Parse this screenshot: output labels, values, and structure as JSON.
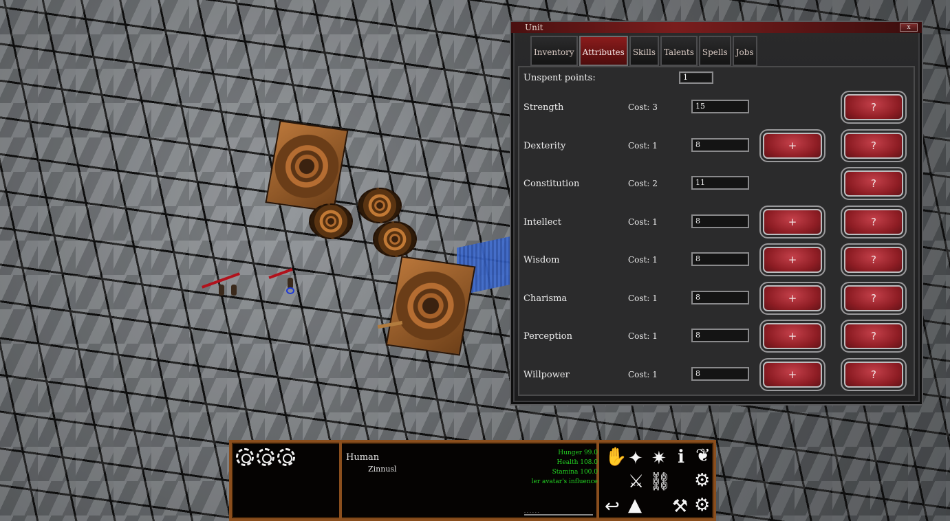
{
  "window": {
    "title": "Unit",
    "close_label": "x",
    "tabs": [
      {
        "label": "Inventory",
        "active": false
      },
      {
        "label": "Attributes",
        "active": true
      },
      {
        "label": "Skills",
        "active": false
      },
      {
        "label": "Talents",
        "active": false
      },
      {
        "label": "Spells",
        "active": false
      },
      {
        "label": "Jobs",
        "active": false
      }
    ],
    "unspent_label": "Unspent points:",
    "unspent_value": "1",
    "plus_label": "+",
    "help_label": "?",
    "attributes": [
      {
        "name": "Strength",
        "cost": "Cost: 3",
        "value": "15",
        "can_raise": false
      },
      {
        "name": "Dexterity",
        "cost": "Cost: 1",
        "value": "8",
        "can_raise": true
      },
      {
        "name": "Constitution",
        "cost": "Cost: 2",
        "value": "11",
        "can_raise": false
      },
      {
        "name": "Intellect",
        "cost": "Cost: 1",
        "value": "8",
        "can_raise": true
      },
      {
        "name": "Wisdom",
        "cost": "Cost: 1",
        "value": "8",
        "can_raise": true
      },
      {
        "name": "Charisma",
        "cost": "Cost: 1",
        "value": "8",
        "can_raise": true
      },
      {
        "name": "Perception",
        "cost": "Cost: 1",
        "value": "8",
        "can_raise": true
      },
      {
        "name": "Willpower",
        "cost": "Cost: 1",
        "value": "8",
        "can_raise": true
      }
    ]
  },
  "hud": {
    "race": "Human",
    "unit_name": "Zinnusl",
    "stats": {
      "hunger": "Hunger 99.0",
      "health": "Health 108.0",
      "stamina": "Stamina 100.0",
      "influence": "ler avatar's influence"
    },
    "colors": {
      "stat_text": "#23d323",
      "frame": "#8a4e1d"
    },
    "action_icons": [
      "hand-icon",
      "sparkle-icon",
      "star-burst-icon",
      "info-icon",
      "wheat-icon",
      "crossed-swords-icon",
      "anvil-icon",
      "gear-icon",
      "back-arrow-icon",
      "robe-icon",
      "anvil-hammer-icon",
      "gear-wrench-icon"
    ]
  },
  "colors": {
    "window_title_bar": "#7a1d1d",
    "button_red": "#8e1d24",
    "active_tab": "#8b1c1c"
  }
}
